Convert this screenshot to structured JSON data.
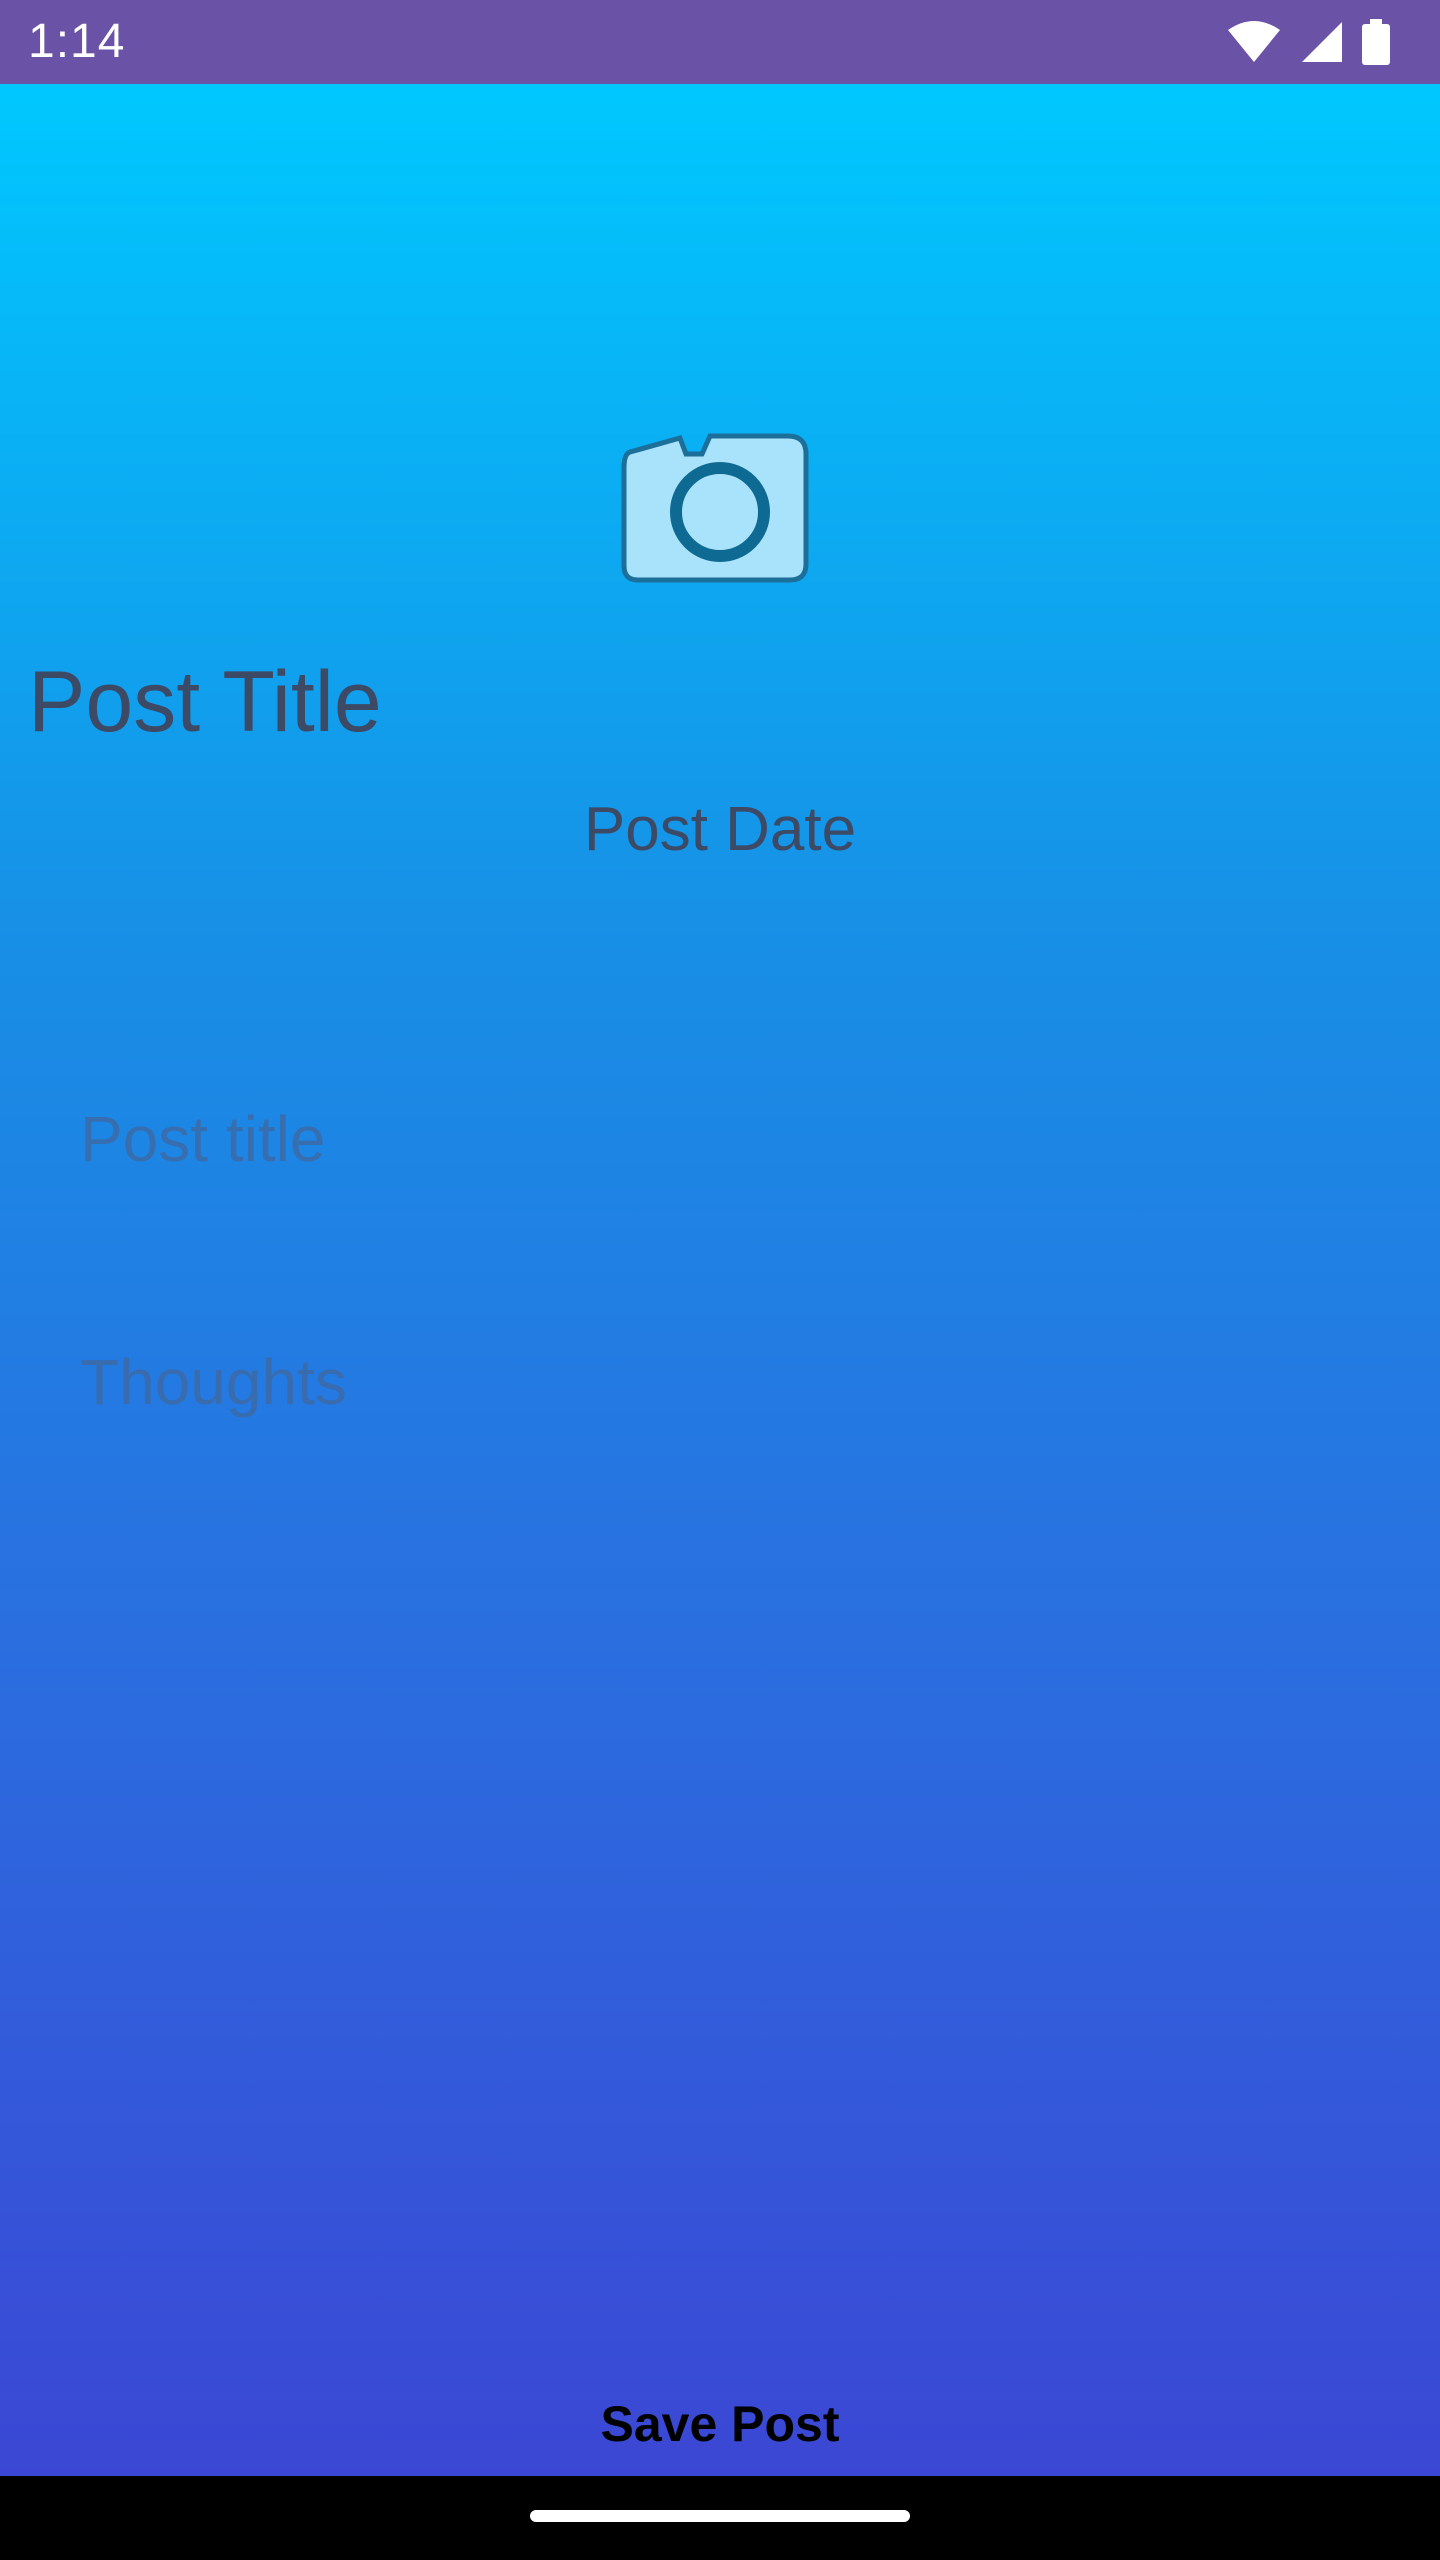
{
  "status_bar": {
    "time": "1:14",
    "icons": [
      "wifi-icon",
      "signal-icon",
      "battery-icon"
    ],
    "background": "#6a52a6"
  },
  "screen": {
    "gradient_top": "#00c8ff",
    "gradient_bottom": "#3b47d4"
  },
  "camera": {
    "icon": "camera-icon"
  },
  "post": {
    "title_heading": "Post Title",
    "date": "Post Date"
  },
  "form": {
    "title_placeholder": "Post title",
    "thoughts_placeholder": "Thoughts"
  },
  "actions": {
    "save_label": "Save Post"
  },
  "nav_bar": {
    "handle": "home-handle"
  }
}
